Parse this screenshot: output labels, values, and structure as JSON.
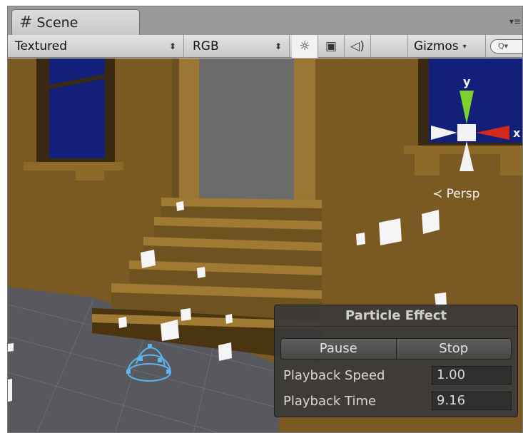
{
  "tab": {
    "icon": "hash-icon",
    "icon_glyph": "#",
    "label": "Scene",
    "menu_glyph": "▾≡"
  },
  "toolbar": {
    "render_mode": "Textured",
    "channel": "RGB",
    "dropdown_arrows": "⬍",
    "light_glyph": "☼",
    "fx_glyph": "▣",
    "audio_glyph": "◁)",
    "gizmos_label": "Gizmos",
    "gizmos_arrow": "▾",
    "search_placeholder": "Q▾"
  },
  "orientation_gizmo": {
    "y_label": "y",
    "x_label": "x",
    "projection_label": "≺ Persp"
  },
  "particle_panel": {
    "title": "Particle Effect",
    "pause_label": "Pause",
    "stop_label": "Stop",
    "speed_label": "Playback Speed",
    "speed_value": "1.00",
    "time_label": "Playback Time",
    "time_value": "9.16"
  },
  "colors": {
    "wall": "#7a5a22",
    "stairs": "#8e6a28",
    "window_glass": "#12207a",
    "floor": "#58595e",
    "gizmo_y": "#7fd12c",
    "gizmo_x": "#d22a1a",
    "emitter": "#5ab4f0"
  }
}
